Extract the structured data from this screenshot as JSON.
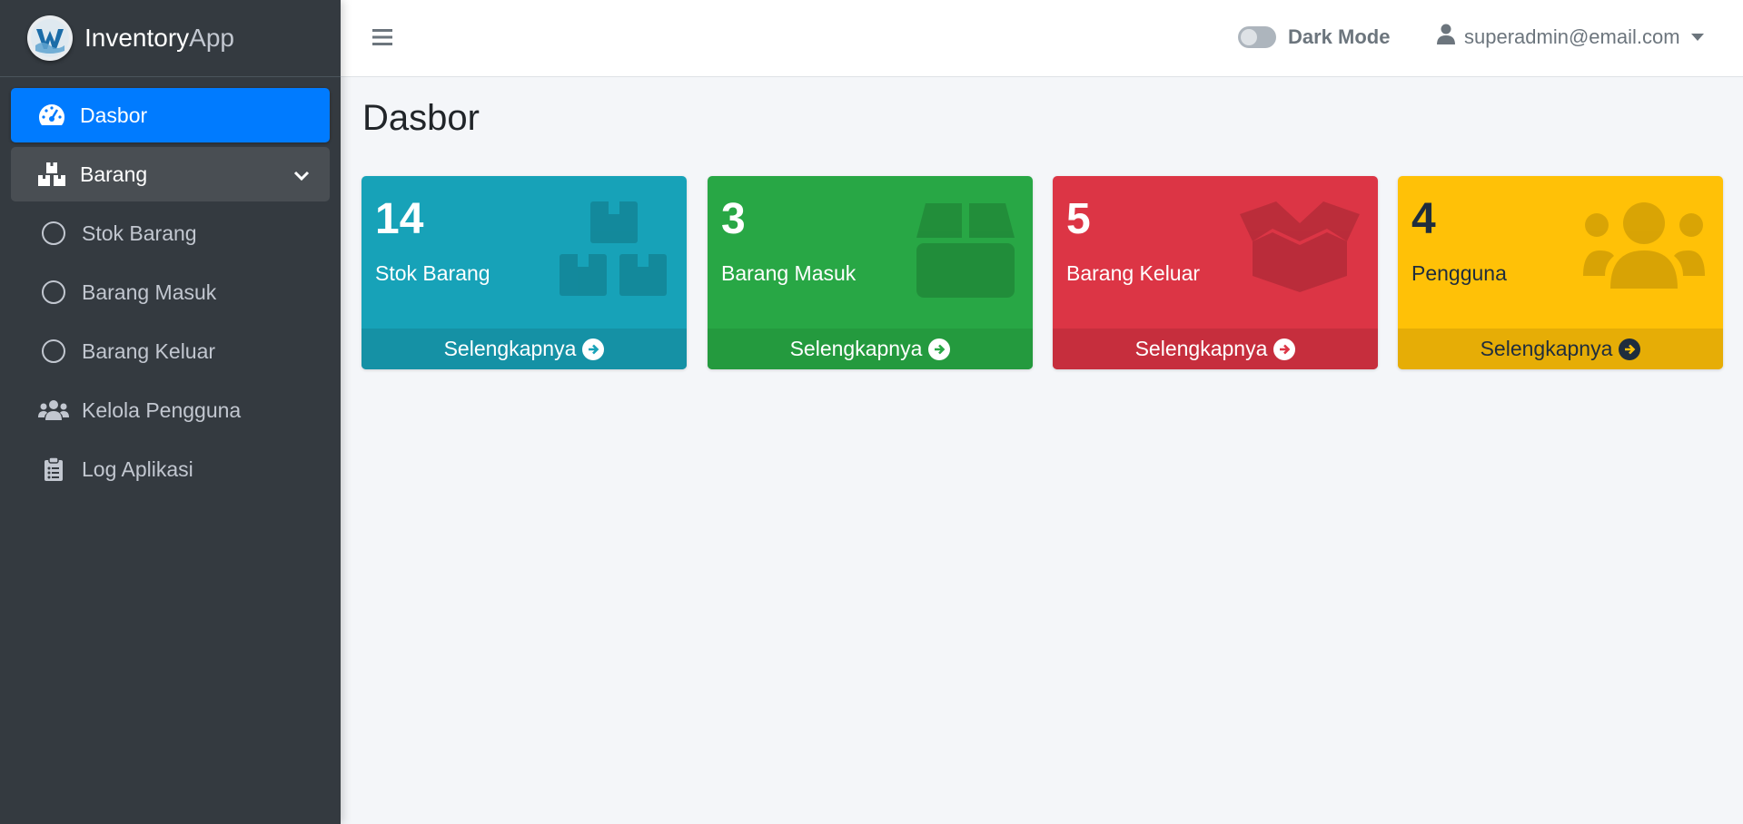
{
  "brand": {
    "name_part1": "Inventory",
    "name_part2": "App"
  },
  "sidebar": {
    "items": [
      {
        "label": "Dasbor",
        "icon": "tachometer-icon",
        "state": "active"
      },
      {
        "label": "Barang",
        "icon": "boxes-icon",
        "state": "open"
      },
      {
        "label": "Stok Barang",
        "icon": "circle-icon"
      },
      {
        "label": "Barang Masuk",
        "icon": "circle-icon"
      },
      {
        "label": "Barang Keluar",
        "icon": "circle-icon"
      },
      {
        "label": "Kelola Pengguna",
        "icon": "users-icon"
      },
      {
        "label": "Log Aplikasi",
        "icon": "clipboard-list-icon"
      }
    ]
  },
  "topbar": {
    "dark_mode_label": "Dark Mode",
    "dark_mode_on": false,
    "user_email": "superadmin@email.com"
  },
  "main": {
    "title": "Dasbor",
    "cards": [
      {
        "count": "14",
        "label": "Stok Barang",
        "link": "Selengkapnya",
        "color": "#17a2b8",
        "footer_color": "#1591a5",
        "icon": "boxes-icon"
      },
      {
        "count": "3",
        "label": "Barang Masuk",
        "link": "Selengkapnya",
        "color": "#28a745",
        "footer_color": "#249a3e",
        "icon": "box-icon"
      },
      {
        "count": "5",
        "label": "Barang Keluar",
        "link": "Selengkapnya",
        "color": "#dc3545",
        "footer_color": "#c62e3d",
        "icon": "box-open-icon"
      },
      {
        "count": "4",
        "label": "Pengguna",
        "link": "Selengkapnya",
        "color": "#ffc107",
        "footer_color": "#e6ad06",
        "icon": "users-icon"
      }
    ]
  }
}
